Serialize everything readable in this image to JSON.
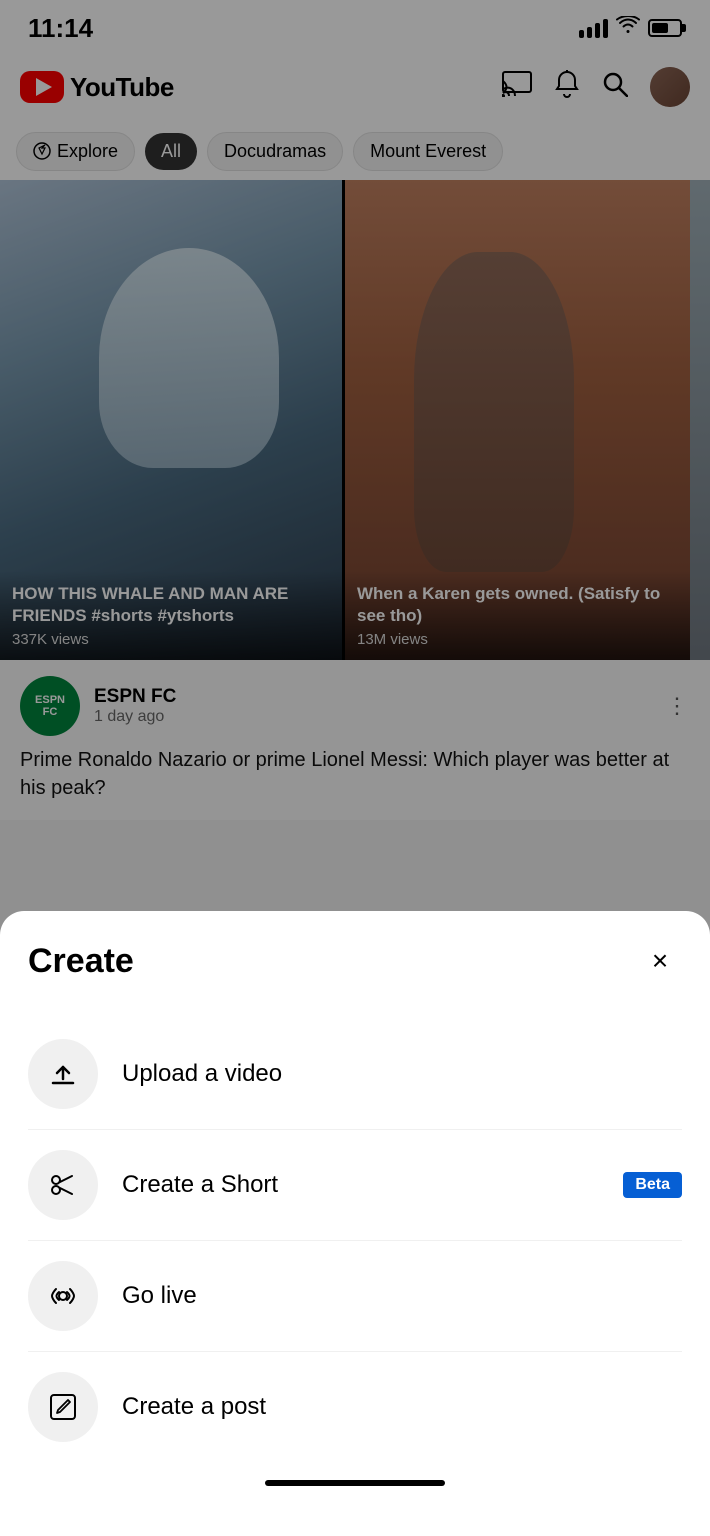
{
  "statusBar": {
    "time": "11:14"
  },
  "header": {
    "logoText": "YouTube",
    "castLabel": "cast",
    "bellLabel": "notifications",
    "searchLabel": "search",
    "profileLabel": "profile"
  },
  "filterChips": {
    "explore": "Explore",
    "all": "All",
    "docudramas": "Docudramas",
    "mountEverest": "Mount Everest"
  },
  "videos": [
    {
      "title": "HOW THIS WHALE AND MAN ARE FRIENDS #shorts #ytshorts",
      "views": "337K views"
    },
    {
      "title": "When a Karen gets owned. (Satisfy to see tho)",
      "views": "13M views"
    }
  ],
  "espn": {
    "channel": "ESPN FC",
    "timeAgo": "1 day ago",
    "articleTitle": "Prime Ronaldo Nazario or prime Lionel Messi: Which player was better at his peak?"
  },
  "createSheet": {
    "title": "Create",
    "closeLabel": "×",
    "items": [
      {
        "id": "upload-video",
        "label": "Upload a video",
        "icon": "upload",
        "badge": null
      },
      {
        "id": "create-short",
        "label": "Create a Short",
        "icon": "scissors",
        "badge": "Beta"
      },
      {
        "id": "go-live",
        "label": "Go live",
        "icon": "live",
        "badge": null
      },
      {
        "id": "create-post",
        "label": "Create a post",
        "icon": "post",
        "badge": null
      }
    ]
  }
}
